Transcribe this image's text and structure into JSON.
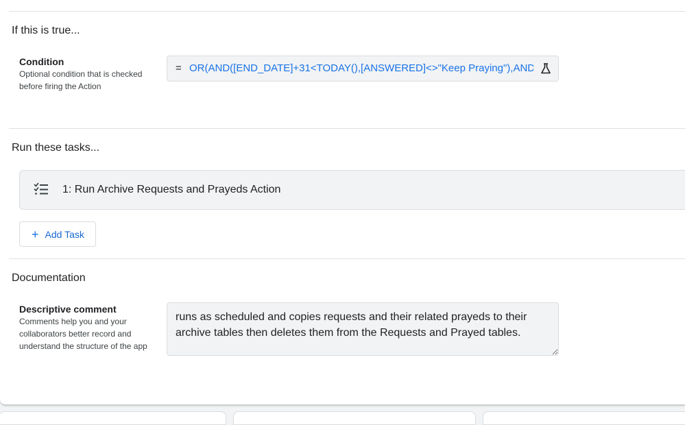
{
  "condition_section": {
    "title": "If this is true...",
    "label": "Condition",
    "help": "Optional condition that is checked before firing the Action",
    "expression_prefix": "=",
    "expression": "OR(AND([END_DATE]+31<TODAY(),[ANSWERED]<>\"Keep Praying\"),AND("
  },
  "tasks_section": {
    "title": "Run these tasks...",
    "tasks": [
      {
        "label": "1: Run Archive Requests and Prayeds Action"
      }
    ],
    "add_task_label": "Add Task"
  },
  "documentation_section": {
    "title": "Documentation",
    "label": "Descriptive comment",
    "help": "Comments help you and your collaborators better record and understand the structure of the app",
    "comment": "runs as scheduled and copies requests and their related prayeds to their archive tables then deletes them from the Requests and Prayed tables."
  },
  "colors": {
    "accent": "#1a73e8",
    "field_bg": "#f1f3f4",
    "border": "#dadce0"
  }
}
